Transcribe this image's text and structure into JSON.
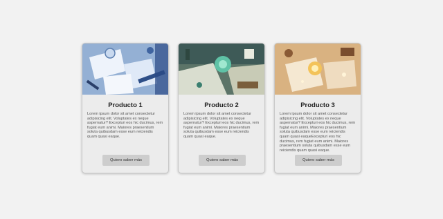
{
  "cards": [
    {
      "title": "Producto 1",
      "text": "Lorem ipsum dolor sit amet consectetur adipisicing elit. Voluptates ex neque aspernatur? Excepturi eos hic ducimus, rem fugiat eum animi. Maiores praesentium soluta quibusdam esse eum reiciendis quam quasi eaque.",
      "button_label": "Quiero saber más",
      "image_theme": "blue"
    },
    {
      "title": "Producto 2",
      "text": "Lorem ipsum dolor sit amet consectetur adipisicing elit. Voluptates ex neque aspernatur? Excepturi eos hic ducimus, rem fugiat eum animi. Maiores praesentium soluta quibusdam esse eum reiciendis quam quasi eaque.",
      "button_label": "Quiero saber más",
      "image_theme": "teal"
    },
    {
      "title": "Producto 3",
      "text": "Lorem ipsum dolor sit amet consectetur adipisicing elit. Voluptates ex neque aspernatur? Excepturi eos hic ducimus, rem fugiat eum animi. Maiores praesentium soluta quibusdam esse eum reiciendis quam quasi eaqueExcepturi eos hic ducimus, rem fugiat eum animi. Maiores praesentium soluta quibusdam esse eum reiciendis quam quasi eaque.",
      "button_label": "Quiero saber más",
      "image_theme": "amber"
    }
  ],
  "colors": {
    "background": "#f2f2f2",
    "card": "#ececec",
    "button": "#cdcdcd"
  }
}
